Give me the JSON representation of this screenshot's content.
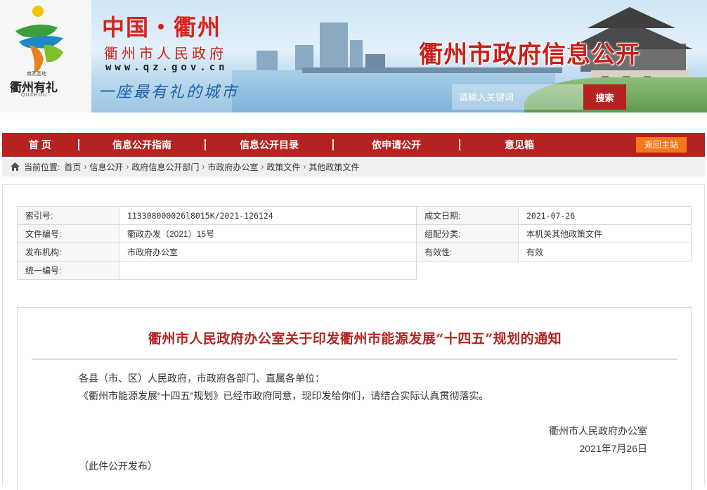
{
  "header": {
    "logo_text": "衢州有礼",
    "logo_small": "南孔圣地",
    "logo_sub": "QUZHOU",
    "china_title": "中国・衢州",
    "gov_name": "衢州市人民政府",
    "url": "www.qz.gov.cn",
    "slogan": "一座最有礼的城市",
    "portal_title": "衢州市政府信息公开",
    "search_placeholder": "请输入关键词",
    "search_button": "搜索"
  },
  "nav": {
    "items": [
      "首 页",
      "信息公开指南",
      "信息公开目录",
      "依申请公开",
      "意见箱"
    ],
    "back_home": "返回主站"
  },
  "breadcrumb": {
    "prefix": "当前位置:",
    "items": [
      "首页",
      "信息公开",
      "政府信息公开部门",
      "市政府办公室",
      "政策文件",
      "其他政策文件"
    ],
    "separator": "›"
  },
  "meta": {
    "rows": [
      {
        "k1": "索引号:",
        "v1": "113308000026l8015K/2021-126124",
        "k2": "成文日期:",
        "v2": "2021-07-26"
      },
      {
        "k1": "文件编号:",
        "v1": "衢政办发（2021）15号",
        "k2": "组配分类:",
        "v2": "本机关其他政策文件"
      },
      {
        "k1": "发布机构:",
        "v1": "市政府办公室",
        "k2": "有效性:",
        "v2": "有效"
      },
      {
        "k1": "统一编号:",
        "v1": ""
      }
    ]
  },
  "doc": {
    "title": "衢州市人民政府办公室关于印发衢州市能源发展“十四五”规划的通知",
    "salutation": "各县（市、区）人民政府，市政府各部门、直属各单位：",
    "body": "《衢州市能源发展“十四五”规划》已经市政府同意，现印发给你们，请结合实际认真贯彻落实。",
    "signature": "衢州市人民政府办公室",
    "date": "2021年7月26日",
    "note": "（此件公开发布）"
  },
  "colors": {
    "brand_red": "#b52320",
    "title_red": "#c8201a",
    "accent_orange": "#f2781a",
    "slogan_blue": "#1c5fa7"
  }
}
